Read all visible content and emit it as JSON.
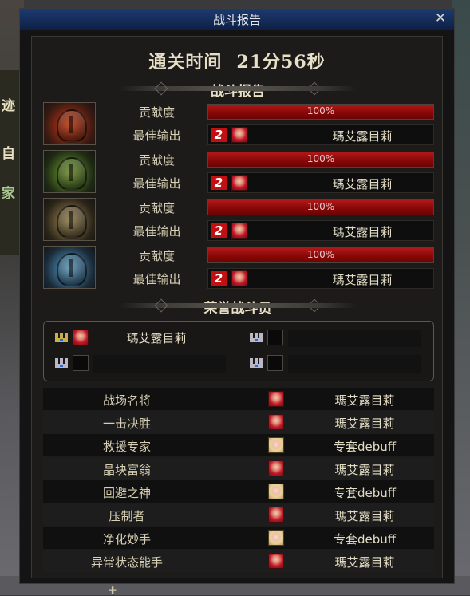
{
  "window": {
    "title": "战斗报告",
    "close_label": "✕"
  },
  "summary": {
    "clear_time_label": "通关时间",
    "clear_time_value": "21分56秒"
  },
  "section_report": {
    "title": "战斗报告"
  },
  "players": [
    {
      "portrait_icon": "red-helmet-icon",
      "contribution_label": "贡献度",
      "contribution_percent": 100,
      "contribution_text": "100%",
      "best_output_label": "最佳输出",
      "rank_badge": "2",
      "best_output_name": "瑪艾露目莉"
    },
    {
      "portrait_icon": "green-helmet-icon",
      "contribution_label": "贡献度",
      "contribution_percent": 100,
      "contribution_text": "100%",
      "best_output_label": "最佳输出",
      "rank_badge": "2",
      "best_output_name": "瑪艾露目莉"
    },
    {
      "portrait_icon": "gold-helmet-icon",
      "contribution_label": "贡献度",
      "contribution_percent": 100,
      "contribution_text": "100%",
      "best_output_label": "最佳输出",
      "rank_badge": "2",
      "best_output_name": "瑪艾露目莉"
    },
    {
      "portrait_icon": "blue-helmet-icon",
      "contribution_label": "贡献度",
      "contribution_percent": 100,
      "contribution_text": "100%",
      "best_output_label": "最佳输出",
      "rank_badge": "2",
      "best_output_name": "瑪艾露目莉"
    }
  ],
  "section_honor": {
    "title": "荣誉战斗员"
  },
  "honor_slots": [
    {
      "crown_color": "#c8b04a",
      "name": "瑪艾露目莉",
      "filled": true
    },
    {
      "crown_color": "#b8b8c8",
      "name": "",
      "filled": false
    },
    {
      "crown_color": "#b8b8c8",
      "name": "",
      "filled": false
    },
    {
      "crown_color": "#b8b8c8",
      "name": "",
      "filled": false
    }
  ],
  "awards": [
    {
      "title": "战场名将",
      "icon": "red-hair-character-icon",
      "player": "瑪艾露目莉"
    },
    {
      "title": "一击决胜",
      "icon": "red-hair-character-icon",
      "player": "瑪艾露目莉"
    },
    {
      "title": "救援专家",
      "icon": "blonde-character-icon",
      "player": "专套debuff"
    },
    {
      "title": "晶块富翁",
      "icon": "red-hair-character-icon",
      "player": "瑪艾露目莉"
    },
    {
      "title": "回避之神",
      "icon": "blonde-character-icon",
      "player": "专套debuff"
    },
    {
      "title": "压制者",
      "icon": "red-hair-character-icon",
      "player": "瑪艾露目莉"
    },
    {
      "title": "净化妙手",
      "icon": "blonde-character-icon",
      "player": "专套debuff"
    },
    {
      "title": "异常状态能手",
      "icon": "red-hair-character-icon",
      "player": "瑪艾露目莉"
    }
  ],
  "background": {
    "left_text_1": "迹",
    "left_text_2": "自",
    "left_text_3": "家",
    "bottom_handle": "✚"
  },
  "colors": {
    "titlebar": "#1d3a70",
    "bar_red": "#b01818",
    "text_gold": "#e7dfc6"
  }
}
